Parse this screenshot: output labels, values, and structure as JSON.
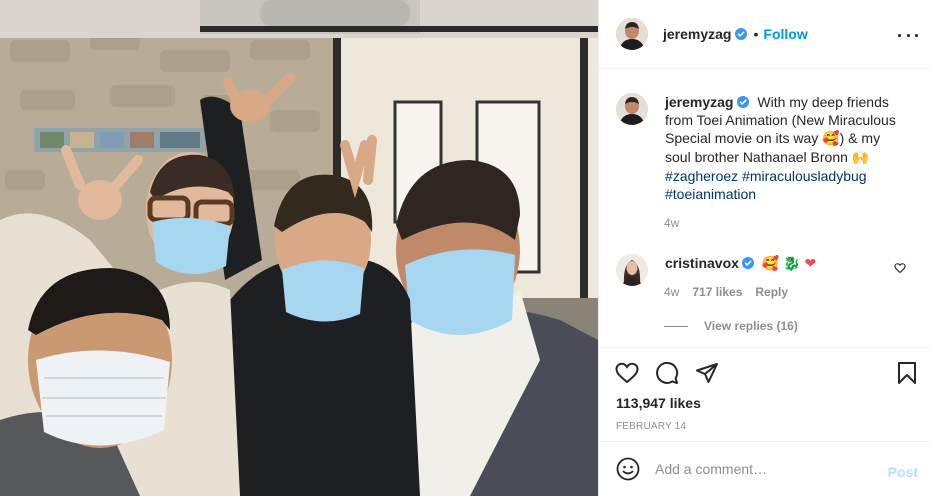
{
  "photo": {
    "alt": "Selfie of four friends wearing face masks"
  },
  "header": {
    "username": "jeremyzag",
    "separator": "•",
    "follow_label": "Follow",
    "more_icon": "more-horizontal-icon"
  },
  "caption": {
    "username": "jeremyzag",
    "text": "With my deep friends from Toei Animation (New Miraculous Special movie on its way",
    "emoji_1": "🥰",
    "text_2": ") & my soul brother Nathanael Bronn",
    "emoji_2": "🙌",
    "hashtags": [
      "#zagheroez",
      "#miraculousladybug",
      "#toeianimation"
    ],
    "time": "4w"
  },
  "comment": {
    "username": "cristinavox",
    "emojis": [
      "🥰",
      "🐉",
      "❤"
    ],
    "time": "4w",
    "likes": "717 likes",
    "reply_label": "Reply",
    "view_replies": "View replies (16)"
  },
  "actions": {
    "icons": [
      "heart-icon",
      "comment-icon",
      "share-icon",
      "bookmark-icon"
    ],
    "likes": "113,947 likes",
    "date": "FEBRUARY 14"
  },
  "add_comment": {
    "placeholder": "Add a comment…",
    "post_label": "Post"
  },
  "colors": {
    "link": "#0095f6",
    "hashtag": "#00376b",
    "muted": "#8e8e8e",
    "border": "#efefef",
    "post_disabled": "#b2dffc"
  }
}
